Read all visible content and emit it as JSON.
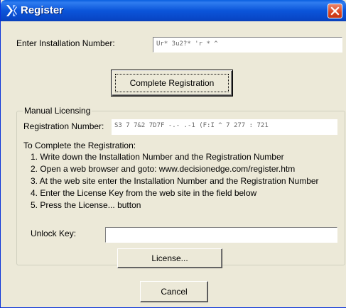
{
  "window": {
    "title": "Register"
  },
  "installation": {
    "label": "Enter Installation Number:",
    "value": "Ur* 3u2?* 'r * ^"
  },
  "buttons": {
    "complete_registration": "Complete Registration",
    "license": "License...",
    "cancel": "Cancel"
  },
  "manual": {
    "group_title": "Manual Licensing",
    "registration_label": "Registration Number:",
    "registration_value": "S3 7 7&2 7D7F  -.- .-1 (F:I ^ 7 277 : 721",
    "instructions_title": "To Complete the Registration:",
    "steps": [
      "1. Write down the Installation Number and the Registration Number",
      "2. Open a web browser and goto:  www.decisionedge.com/register.htm",
      "3. At the web site enter the Installation Number and the Registration Number",
      "4. Enter the License Key from the web site in the field below",
      "5. Press the License... button"
    ],
    "unlock_label": "Unlock Key:",
    "unlock_value": ""
  },
  "icons": {
    "app": "decisionedge-logo-icon",
    "close": "close-icon"
  },
  "colors": {
    "titlebar": "#0b55da",
    "close": "#d8431f",
    "dialog_bg": "#ece9d8"
  }
}
